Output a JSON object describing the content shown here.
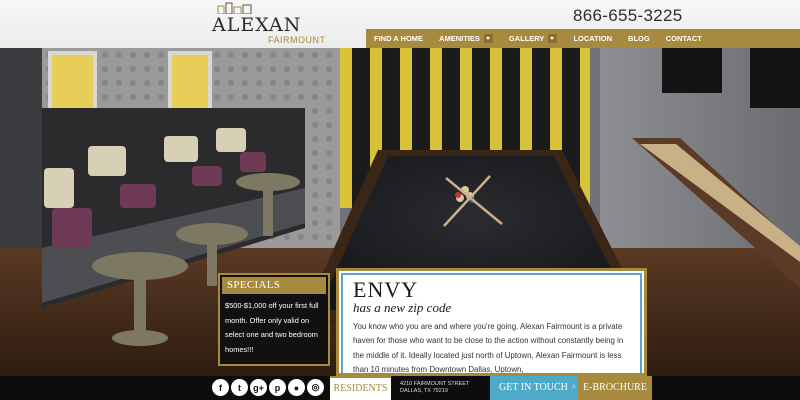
{
  "brand": {
    "name": "ALEXAN",
    "sub": "FAIRMOUNT"
  },
  "header": {
    "phone": "866-655-3225"
  },
  "nav": {
    "items": [
      {
        "label": "FIND A HOME",
        "dropdown": false
      },
      {
        "label": "AMENITIES",
        "dropdown": true
      },
      {
        "label": "GALLERY",
        "dropdown": true
      },
      {
        "label": "LOCATION",
        "dropdown": false
      },
      {
        "label": "BLOG",
        "dropdown": false
      },
      {
        "label": "CONTACT",
        "dropdown": false
      }
    ]
  },
  "specials": {
    "title": "SPECIALS",
    "text": "$500-$1,000 off your first full month. Offer only valid on select one and two bedroom homes!!!"
  },
  "content": {
    "title": "ENVY",
    "subtitle": "has a new zip code",
    "body": "You know who you are and where you're going. Alexan Fairmount is a private haven for those who want to be close to the action without constantly being in the middle of it. Ideally located just north of Uptown, Alexan Fairmount is less than 10 minutes from Downtown Dallas, Uptown,"
  },
  "footer": {
    "socials": [
      {
        "name": "facebook-icon",
        "glyph": "f"
      },
      {
        "name": "twitter-icon",
        "glyph": "t"
      },
      {
        "name": "google-plus-icon",
        "glyph": "g+"
      },
      {
        "name": "pinterest-icon",
        "glyph": "p"
      },
      {
        "name": "map-pin-icon",
        "glyph": "●"
      },
      {
        "name": "instagram-icon",
        "glyph": "◎"
      }
    ],
    "residents": "RESIDENTS",
    "address_line1": "4210 FAIRMOUNT STREET",
    "address_line2": "DALLAS, TX 75219",
    "get_in_touch": "GET IN TOUCH",
    "get_in_touch_caret": "^",
    "ebrochure": "E-BROCHURE"
  },
  "colors": {
    "gold": "#a78a3e",
    "blue": "#4faac9",
    "dark": "#0d0d0d"
  }
}
